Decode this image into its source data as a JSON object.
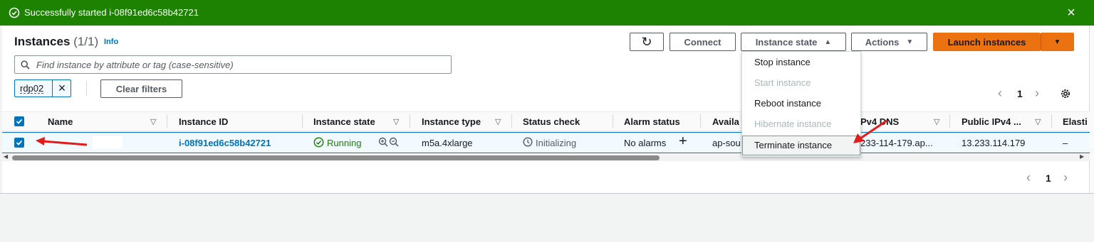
{
  "banner": {
    "message": "Successfully started i-08f91ed6c58b42721",
    "close_glyph": "×",
    "color": "#1d8102"
  },
  "header": {
    "title": "Instances",
    "count": "(1/1)",
    "info": "Info",
    "buttons": {
      "refresh_glyph": "↻",
      "connect": "Connect",
      "instance_state": "Instance state",
      "actions": "Actions",
      "launch": "Launch instances"
    }
  },
  "search": {
    "placeholder": "Find instance by attribute or tag (case-sensitive)",
    "value": ""
  },
  "filters": {
    "token": "rdp02",
    "token_remove_glyph": "×",
    "clear": "Clear filters"
  },
  "pagination": {
    "page": "1",
    "prev_glyph": "‹",
    "next_glyph": "›"
  },
  "table": {
    "columns": [
      "Name",
      "Instance ID",
      "Instance state",
      "Instance type",
      "Status check",
      "Alarm status",
      "Availa",
      "Pv4 DNS",
      "Public IPv4 ...",
      "Elasti"
    ],
    "row": {
      "name": "",
      "instance_id": "i-08f91ed6c58b42721",
      "state": "Running",
      "type": "m5a.4xlarge",
      "status_check": "Initializing",
      "alarm_status": "No alarms",
      "add_glyph": "+",
      "availability_zone": "ap-sou",
      "public_dns": "233-114-179.ap...",
      "public_ipv4": "13.233.114.179",
      "elastic_ip": "–"
    }
  },
  "dropdown": {
    "items": [
      {
        "label": "Stop instance",
        "enabled": true
      },
      {
        "label": "Start instance",
        "enabled": false
      },
      {
        "label": "Reboot instance",
        "enabled": true
      },
      {
        "label": "Hibernate instance",
        "enabled": false
      },
      {
        "label": "Terminate instance",
        "enabled": true,
        "highlighted": true
      }
    ]
  },
  "colors": {
    "accent": "#0073bb",
    "launch": "#ec7211",
    "success": "#1d8102",
    "annotation_arrow": "#e31b1b"
  }
}
